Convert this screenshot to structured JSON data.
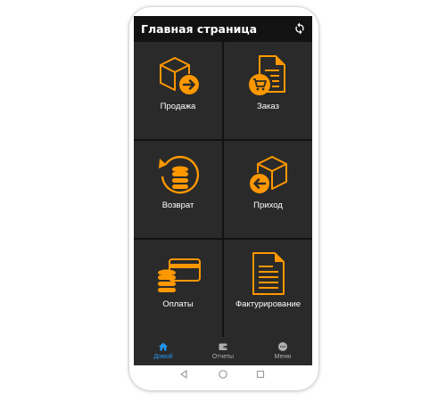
{
  "app": {
    "title": "Главная страница"
  },
  "colors": {
    "accent": "#ff9800",
    "nav_active": "#2196f3",
    "nav_inactive": "#b0b0b0"
  },
  "tiles": [
    {
      "label": "Продажа",
      "icon": "box-arrow-out-icon"
    },
    {
      "label": "Заказ",
      "icon": "document-cart-icon"
    },
    {
      "label": "Возврат",
      "icon": "coins-return-icon"
    },
    {
      "label": "Приход",
      "icon": "box-arrow-in-icon"
    },
    {
      "label": "Оплаты",
      "icon": "card-coins-icon"
    },
    {
      "label": "Фактурирование",
      "icon": "invoice-document-icon"
    }
  ],
  "bottom_nav": [
    {
      "label": "Домой",
      "icon": "home-icon",
      "active": true
    },
    {
      "label": "Отчеты",
      "icon": "wallet-icon",
      "active": false
    },
    {
      "label": "Меню",
      "icon": "more-dots-icon",
      "active": false
    }
  ],
  "system_nav": [
    "back-icon",
    "home-circle-icon",
    "recents-icon"
  ]
}
